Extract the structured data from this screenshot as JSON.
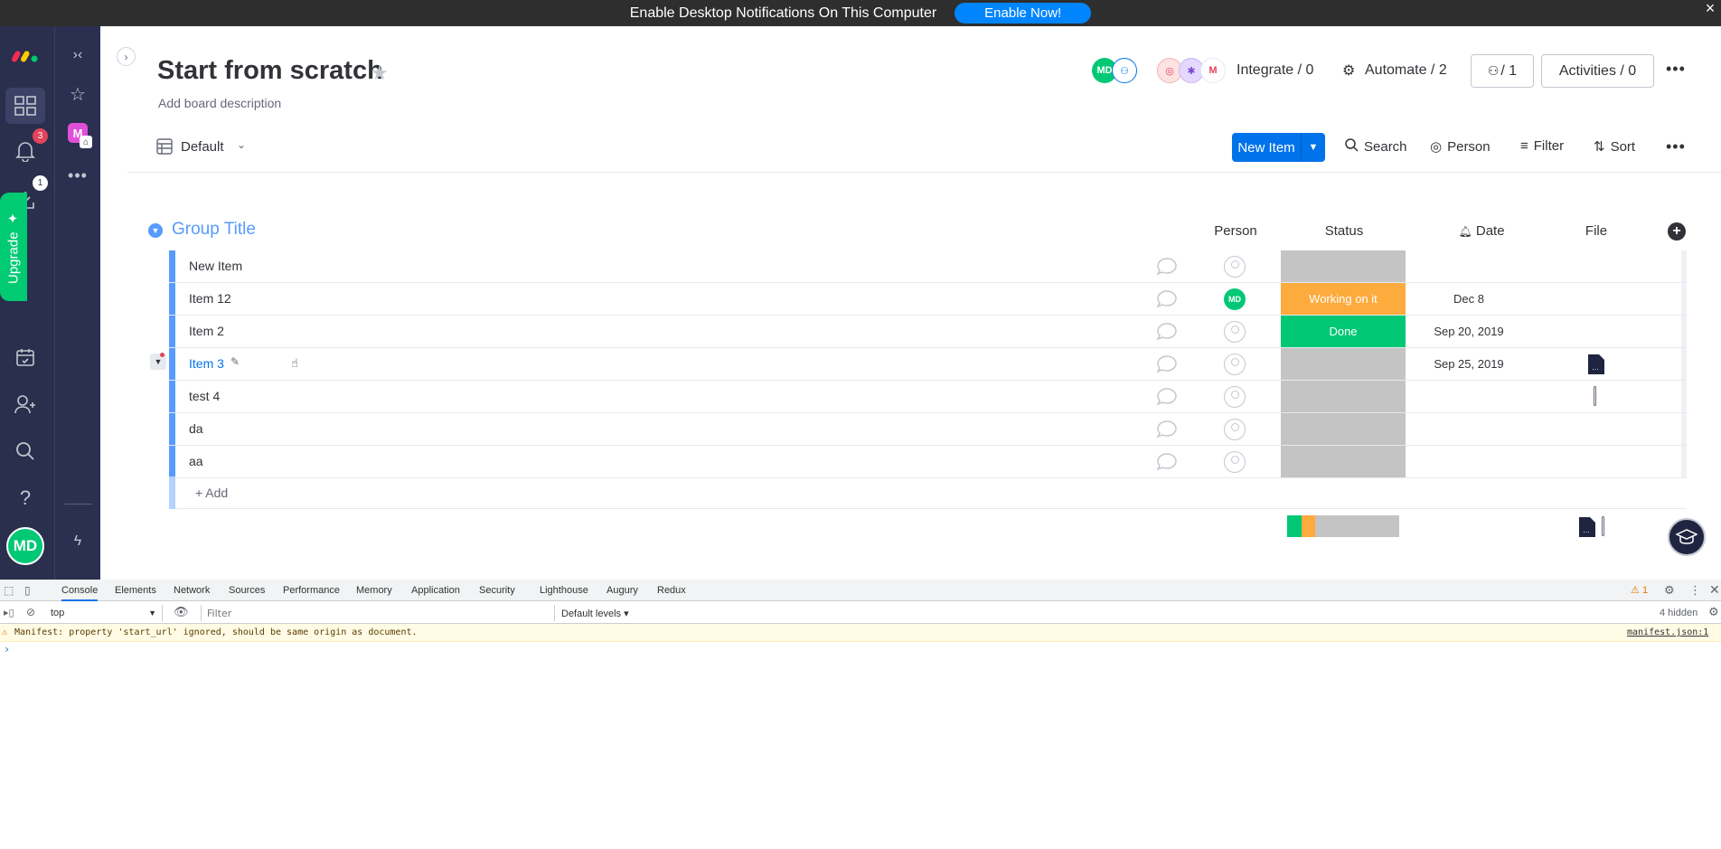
{
  "notification": {
    "message": "Enable Desktop Notifications On This Computer",
    "button": "Enable Now!",
    "close": "×"
  },
  "left_rail": {
    "notifications_badge": "3",
    "inbox_badge": "1",
    "upgrade_label": "Upgrade",
    "avatar_initials": "MD"
  },
  "board_rail": {
    "workspace_letter": "M"
  },
  "board": {
    "title": "Start from scratch",
    "description": "Add board description",
    "integrate_label": "Integrate / 0",
    "automate_label": "Automate / 2",
    "members_label": "/ 1",
    "activities_label": "Activities / 0",
    "header_avatar": "MD"
  },
  "toolbar": {
    "view_label": "Default",
    "new_item_label": "New Item",
    "search_label": "Search",
    "person_label": "Person",
    "filter_label": "Filter",
    "sort_label": "Sort"
  },
  "group": {
    "title": "Group Title",
    "columns": {
      "person": "Person",
      "status": "Status",
      "date": "Date",
      "file": "File"
    },
    "add_label": "+ Add"
  },
  "rows": [
    {
      "name": "New Item",
      "person": "",
      "status": "",
      "date": ""
    },
    {
      "name": "Item 12",
      "person": "MD",
      "status": "Working on it",
      "date": "Dec 8"
    },
    {
      "name": "Item 2",
      "person": "",
      "status": "Done",
      "date": "Sep 20, 2019"
    },
    {
      "name": "Item 3",
      "person": "",
      "status": "",
      "date": "Sep 25, 2019"
    },
    {
      "name": "test 4",
      "person": "",
      "status": "",
      "date": ""
    },
    {
      "name": "da",
      "person": "",
      "status": "",
      "date": ""
    },
    {
      "name": "aa",
      "person": "",
      "status": "",
      "date": ""
    }
  ],
  "colors": {
    "working_on_it": "#fdab3d",
    "done": "#00c875",
    "empty_status": "#c4c4c4",
    "group_accent": "#579bfc",
    "primary": "#0073ea"
  },
  "summary": {
    "status_fractions": [
      0.125,
      0.125,
      0.75
    ]
  },
  "devtools": {
    "tabs": [
      "Console",
      "Elements",
      "Network",
      "Sources",
      "Performance",
      "Memory",
      "Application",
      "Security",
      "Lighthouse",
      "Augury",
      "Redux"
    ],
    "context": "top",
    "filter_placeholder": "Filter",
    "levels": "Default levels ▾",
    "warning_count": "1",
    "hidden": "4 hidden",
    "warning_message": "Manifest: property 'start_url' ignored, should be same origin as document.",
    "warning_source": "manifest.json:1",
    "prompt": "›"
  }
}
